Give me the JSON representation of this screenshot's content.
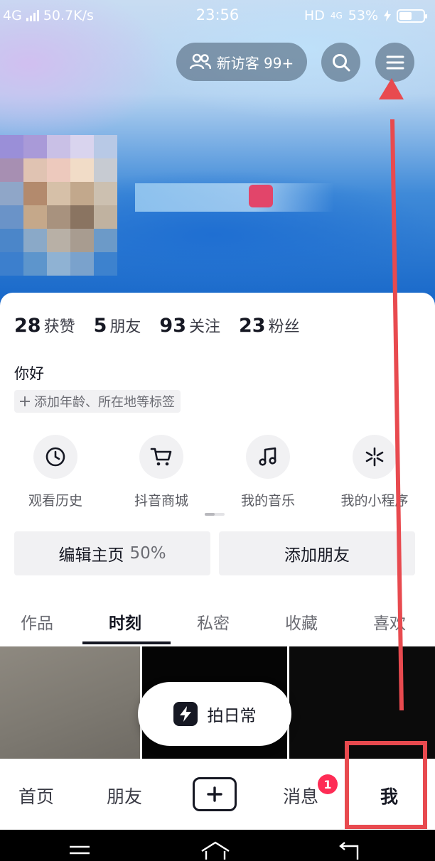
{
  "status_bar": {
    "network": "4G",
    "speed": "50.7K/s",
    "time": "23:56",
    "hd": "HD",
    "network_right": "4G",
    "battery": "53%",
    "battery_level": 0.53
  },
  "header": {
    "visitors_label": "新访客 99+",
    "search_icon": "search-icon",
    "menu_icon": "menu-icon"
  },
  "stats": [
    {
      "num": "28",
      "label": "获赞"
    },
    {
      "num": "5",
      "label": "朋友"
    },
    {
      "num": "93",
      "label": "关注"
    },
    {
      "num": "23",
      "label": "粉丝"
    }
  ],
  "bio": "你好",
  "tag_label": "添加年龄、所在地等标签",
  "shortcuts": [
    {
      "label": "观看历史",
      "icon": "clock-icon"
    },
    {
      "label": "抖音商城",
      "icon": "cart-icon"
    },
    {
      "label": "我的音乐",
      "icon": "music-icon"
    },
    {
      "label": "我的小程序",
      "icon": "asterisk-icon"
    }
  ],
  "actions": {
    "edit_label": "编辑主页",
    "edit_progress": "50%",
    "add_friend_label": "添加朋友"
  },
  "tabs": [
    "作品",
    "时刻",
    "私密",
    "收藏",
    "喜欢"
  ],
  "active_tab": "时刻",
  "shoot_label": "拍日常",
  "bottom_nav": {
    "home": "首页",
    "friends": "朋友",
    "messages": "消息",
    "messages_badge": "1",
    "me": "我"
  },
  "colors": {
    "accent": "#fe2c55",
    "annotation": "#e84a4f",
    "text": "#161823"
  }
}
